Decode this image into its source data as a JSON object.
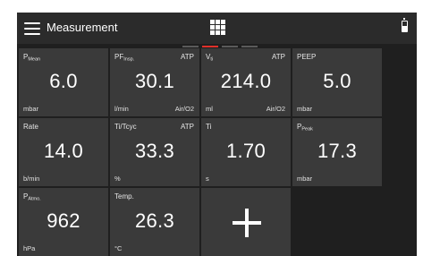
{
  "header": {
    "title": "Measurement",
    "menu_icon": "hamburger-menu-icon",
    "grid_icon": "grid-view-icon",
    "battery_icon": "battery-icon"
  },
  "pager": {
    "pages": 4,
    "active_index": 1,
    "active_color": "#e0302a"
  },
  "tiles": [
    {
      "label": "P",
      "sub": "Mean",
      "tag": "",
      "value": "6.0",
      "unit": "mbar",
      "gas": ""
    },
    {
      "label": "PF",
      "sub": "Insp.",
      "tag": "ATP",
      "value": "30.1",
      "unit": "l/min",
      "gas": "Air/O2"
    },
    {
      "label": "V",
      "sub": "ti",
      "tag": "ATP",
      "value": "214.0",
      "unit": "ml",
      "gas": "Air/O2"
    },
    {
      "label": "PEEP",
      "sub": "",
      "tag": "",
      "value": "5.0",
      "unit": "mbar",
      "gas": ""
    },
    {
      "label": "Rate",
      "sub": "",
      "tag": "",
      "value": "14.0",
      "unit": "b/min",
      "gas": ""
    },
    {
      "label": "Ti/Tcyc",
      "sub": "",
      "tag": "ATP",
      "value": "33.3",
      "unit": "%",
      "gas": ""
    },
    {
      "label": "Ti",
      "sub": "",
      "tag": "",
      "value": "1.70",
      "unit": "s",
      "gas": ""
    },
    {
      "label": "P",
      "sub": "Peak",
      "tag": "",
      "value": "17.3",
      "unit": "mbar",
      "gas": ""
    },
    {
      "label": "P",
      "sub": "Atmo.",
      "tag": "",
      "value": "962",
      "unit": "hPa",
      "gas": ""
    },
    {
      "label": "Temp.",
      "sub": "",
      "tag": "",
      "value": "26.3",
      "unit": "°C",
      "gas": ""
    }
  ],
  "add_tile": {
    "icon": "plus-icon"
  },
  "colors": {
    "tile_bg": "#3a3a3a",
    "screen_bg": "#1f1f1f",
    "text": "#ffffff"
  }
}
